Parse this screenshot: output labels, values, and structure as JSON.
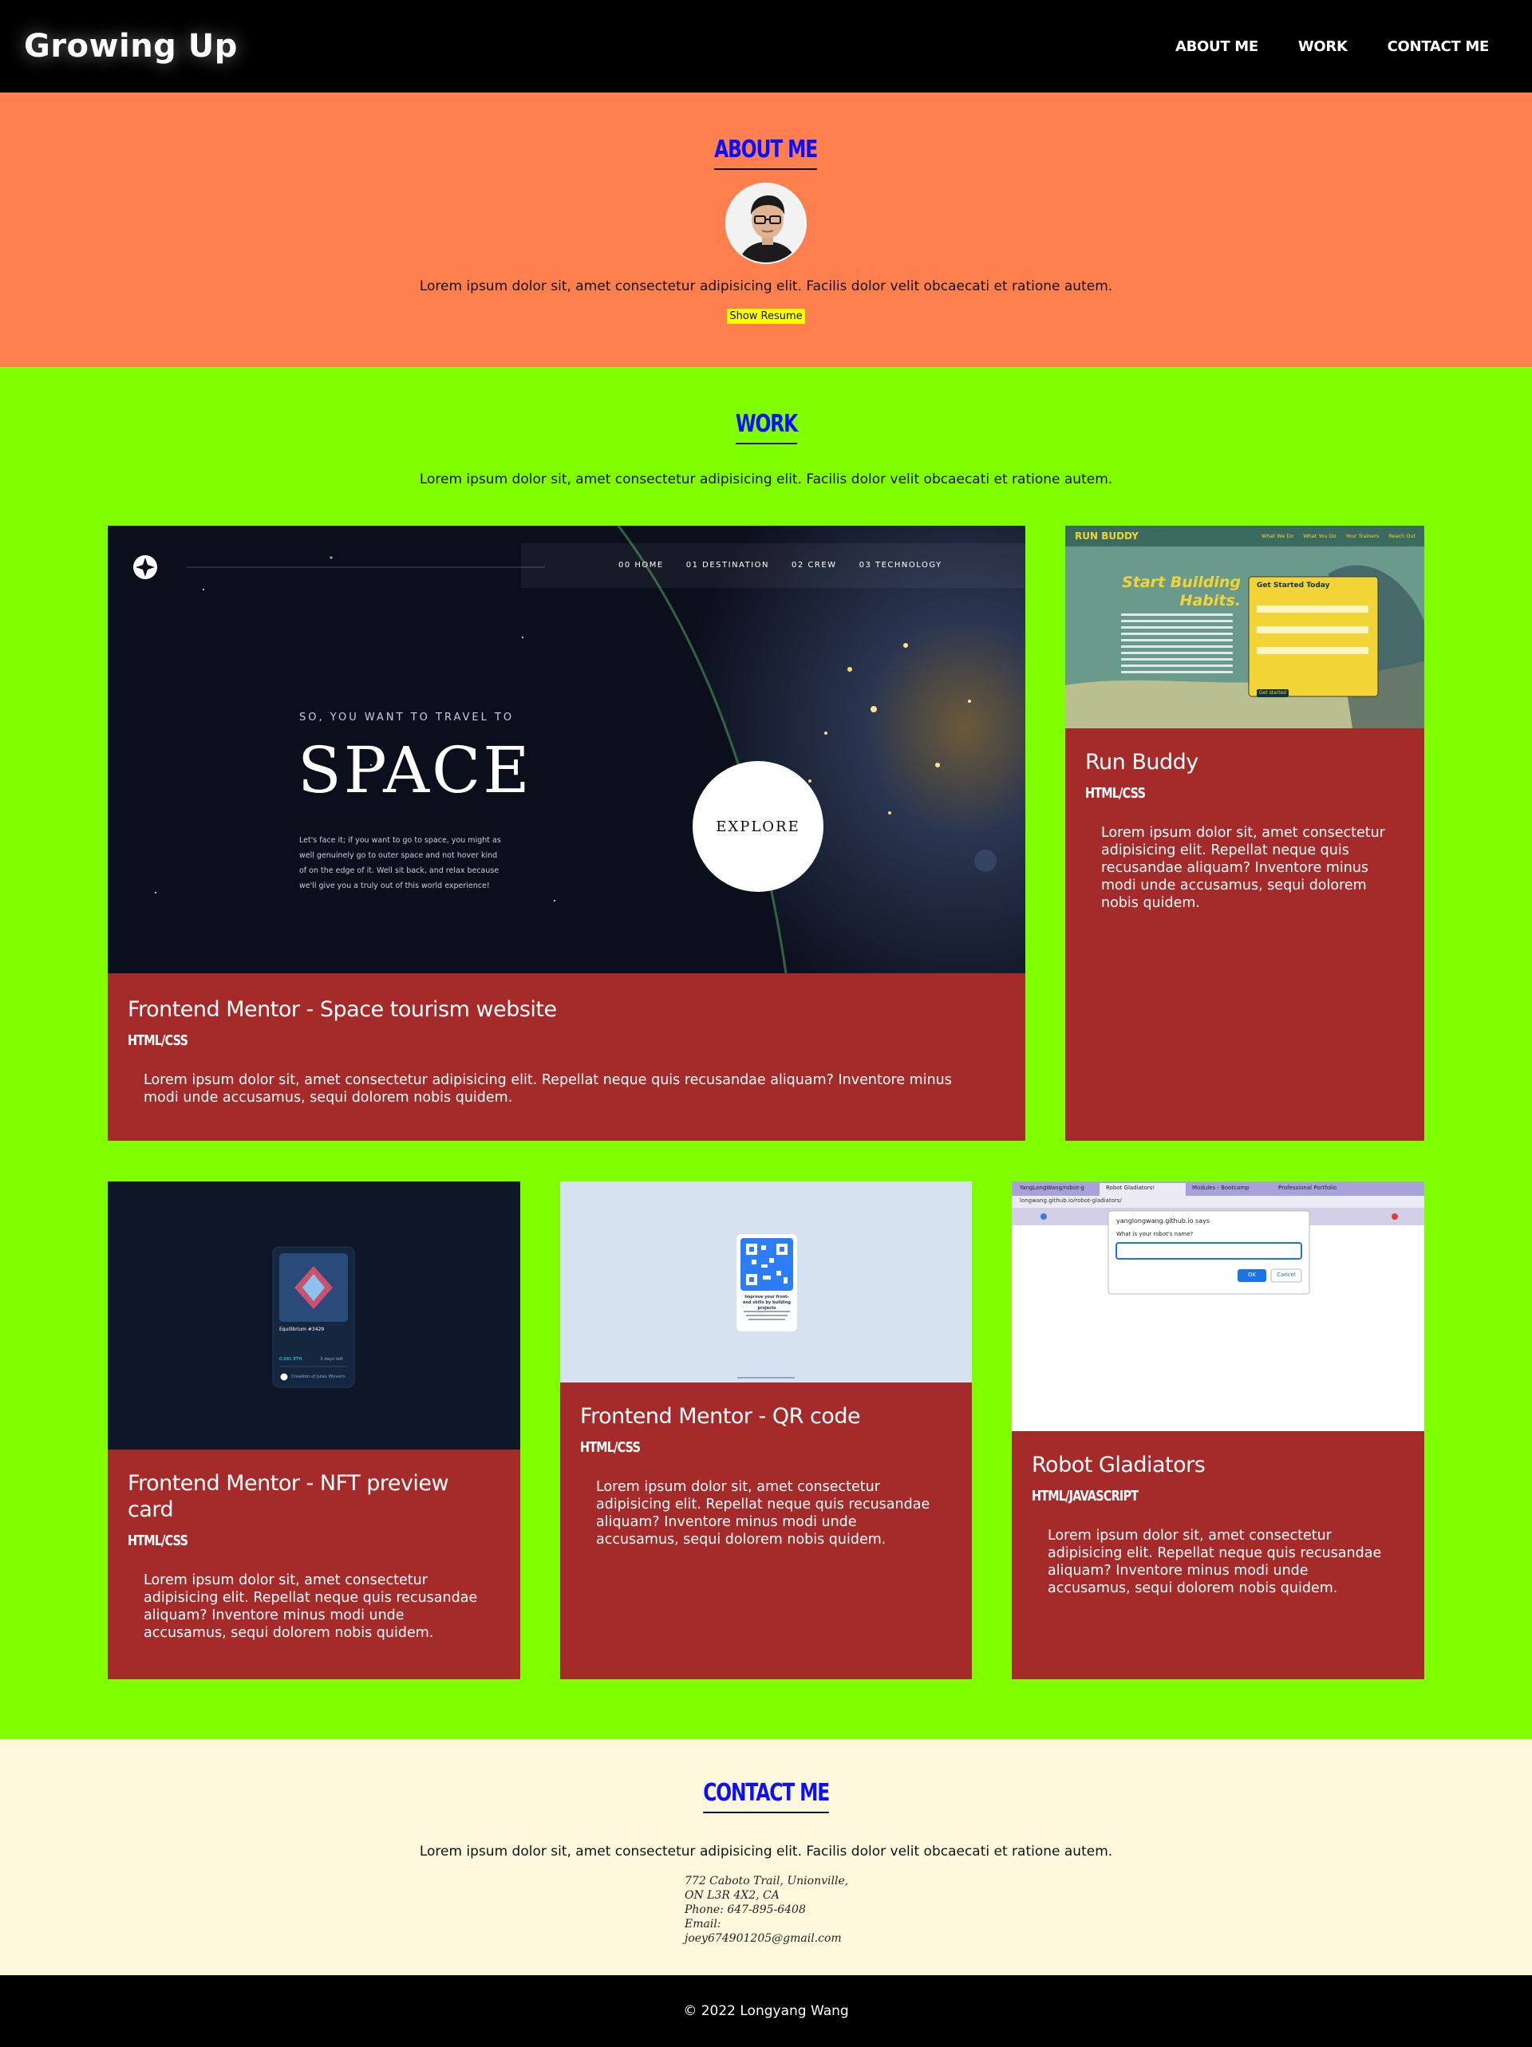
{
  "header": {
    "title": "Growing Up",
    "nav": [
      "ABOUT ME",
      "WORK",
      "CONTACT ME"
    ]
  },
  "about": {
    "heading": "ABOUT ME",
    "text": "Lorem ipsum dolor sit, amet consectetur adipisicing elit. Facilis dolor velit obcaecati et ratione autem.",
    "resume_label": "Show Resume"
  },
  "work": {
    "heading": "WORK",
    "text": "Lorem ipsum dolor sit, amet consectetur adipisicing elit. Facilis dolor velit obcaecati et ratione autem.",
    "projects": [
      {
        "title": "Frontend Mentor - Space tourism website",
        "tech": "HTML/CSS",
        "desc": "Lorem ipsum dolor sit, amet consectetur adipisicing elit. Repellat neque quis recusandae aliquam? Inventore minus modi unde accusamus, sequi dolorem nobis quidem.",
        "preview": {
          "nav": [
            "00 HOME",
            "01 DESTINATION",
            "02 CREW",
            "03 TECHNOLOGY"
          ],
          "kicker": "SO, YOU WANT TO TRAVEL TO",
          "headline": "SPACE",
          "blurb": "Let's face it; if you want to go to space, you might as well genuinely go to outer space and not hover kind of on the edge of it. Well sit back, and relax because we'll give you a truly out of this world experience!",
          "cta": "EXPLORE"
        }
      },
      {
        "title": "Run Buddy",
        "tech": "HTML/CSS",
        "desc": "Lorem ipsum dolor sit, amet consectetur adipisicing elit. Repellat neque quis recusandae aliquam? Inventore minus modi unde accusamus, sequi dolorem nobis quidem.",
        "preview": {
          "brand": "RUN BUDDY",
          "nav": [
            "What We Do",
            "What You Do",
            "Your Trainers",
            "Reach Out"
          ],
          "headline": "Start Building Habits.",
          "form_title": "Get Started Today",
          "button": "Get started"
        }
      },
      {
        "title": "Frontend Mentor - NFT preview card",
        "tech": "HTML/CSS",
        "desc": "Lorem ipsum dolor sit, amet consectetur adipisicing elit. Repellat neque quis recusandae aliquam? Inventore minus modi unde accusamus, sequi dolorem nobis quidem.",
        "preview": {
          "name": "Equilibrium #3429",
          "price": "0.041 ETH",
          "days": "3 days left",
          "creator": "Creation of Jules Wyvern"
        }
      },
      {
        "title": "Frontend Mentor - QR code",
        "tech": "HTML/CSS",
        "desc": "Lorem ipsum dolor sit, amet consectetur adipisicing elit. Repellat neque quis recusandae aliquam? Inventore minus modi unde accusamus, sequi dolorem nobis quidem.",
        "preview": {
          "caption": "Improve your front-end skills by building projects"
        }
      },
      {
        "title": "Robot Gladiators",
        "tech": "HTML/JAVASCRIPT",
        "desc": "Lorem ipsum dolor sit, amet consectetur adipisicing elit. Repellat neque quis recusandae aliquam? Inventore minus modi unde accusamus, sequi dolorem nobis quidem.",
        "preview": {
          "tabs": [
            "YangLongWang/robot-g",
            "Robot Gladiators!",
            "Modules - Bootcamp",
            "Professional Portfolio"
          ],
          "url": "longwang.github.io/robot-gladiators/",
          "dialog_title": "yanglongwang.github.io says",
          "dialog_prompt": "What is your robot's name?",
          "ok": "OK",
          "cancel": "Cancel"
        }
      }
    ]
  },
  "contact": {
    "heading": "CONTACT ME",
    "text": "Lorem ipsum dolor sit, amet consectetur adipisicing elit. Facilis dolor velit obcaecati et ratione autem.",
    "address": [
      "772 Caboto Trail, Unionville,",
      "ON L3R 4X2, CA",
      "Phone: 647-895-6408",
      "Email: joey674901205@gmail.com"
    ]
  },
  "footer": {
    "text": "© 2022 Longyang Wang"
  }
}
